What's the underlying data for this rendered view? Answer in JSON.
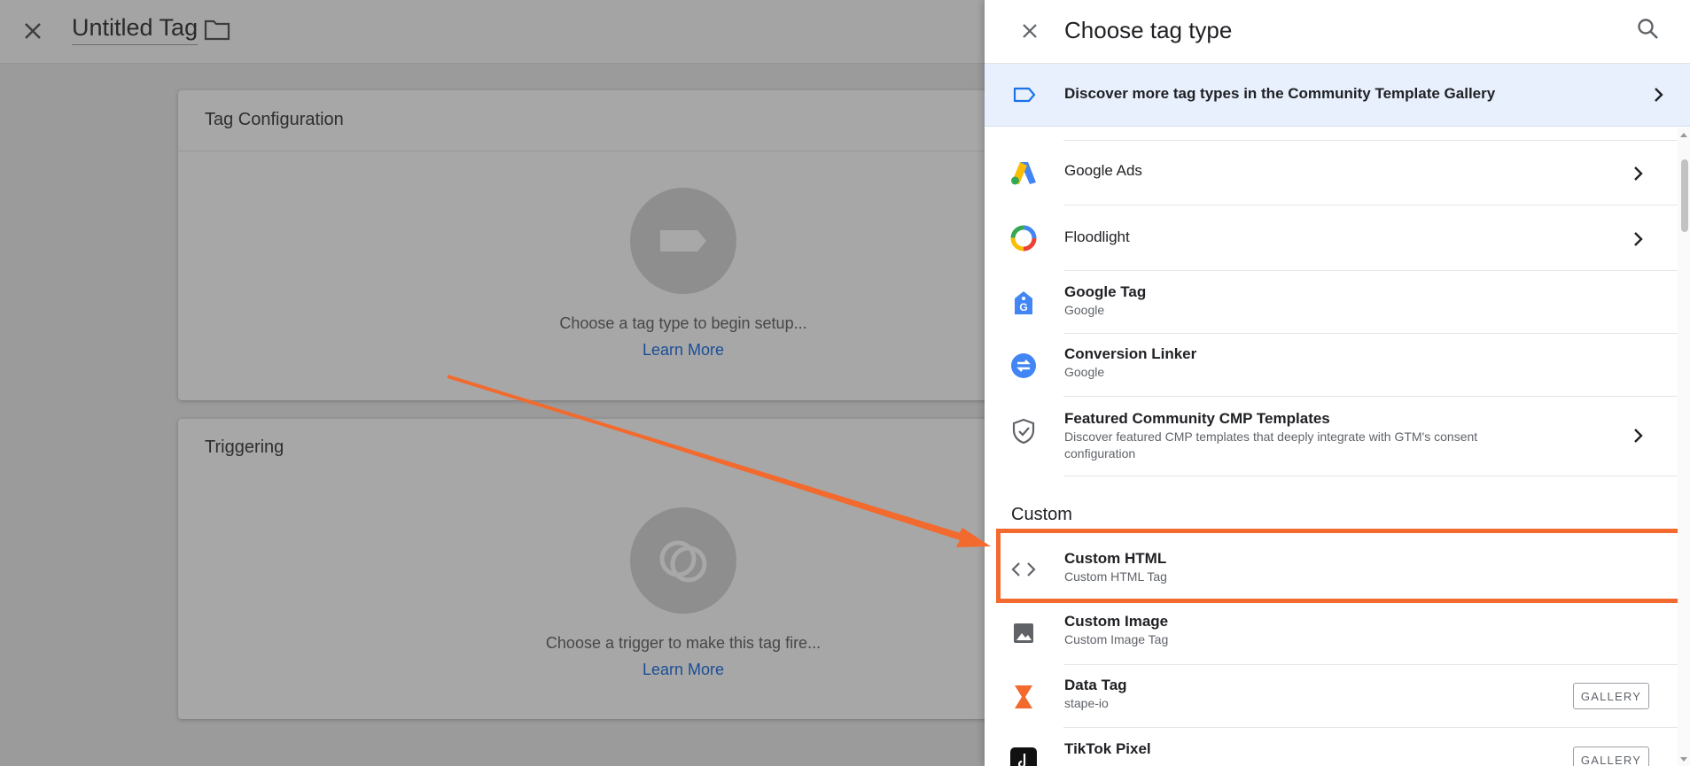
{
  "editor": {
    "tag_name": "Untitled Tag",
    "config_card": {
      "title": "Tag Configuration",
      "hint": "Choose a tag type to begin setup...",
      "link": "Learn More"
    },
    "trigger_card": {
      "title": "Triggering",
      "hint": "Choose a trigger to make this tag fire...",
      "link": "Learn More"
    }
  },
  "panel": {
    "title": "Choose tag type",
    "banner": "Discover more tag types in the Community Template Gallery",
    "items": [
      {
        "title": "Google Ads",
        "icon": "google-ads-icon"
      },
      {
        "title": "Floodlight",
        "icon": "floodlight-icon"
      },
      {
        "title": "Google Tag",
        "subtitle": "Google",
        "icon": "google-tag-icon"
      },
      {
        "title": "Conversion Linker",
        "subtitle": "Google",
        "icon": "conversion-linker-icon"
      },
      {
        "title": "Featured Community CMP Templates",
        "subtitle_line1": "Discover featured CMP templates that deeply integrate with GTM's consent",
        "subtitle_line2": "configuration",
        "icon": "shield-check-icon"
      }
    ],
    "custom_section_label": "Custom",
    "custom_items": [
      {
        "title": "Custom HTML",
        "subtitle": "Custom HTML Tag",
        "icon": "code-icon"
      },
      {
        "title": "Custom Image",
        "subtitle": "Custom Image Tag",
        "icon": "image-icon"
      },
      {
        "title": "Data Tag",
        "subtitle": "stape-io",
        "badge": "GALLERY",
        "icon": "data-tag-icon"
      },
      {
        "title": "TikTok Pixel",
        "badge": "GALLERY",
        "icon": "tiktok-icon"
      }
    ]
  },
  "colors": {
    "accent_highlight": "#f26a2e",
    "link": "#1b4e96",
    "banner_bg": "#e8f0fe"
  }
}
